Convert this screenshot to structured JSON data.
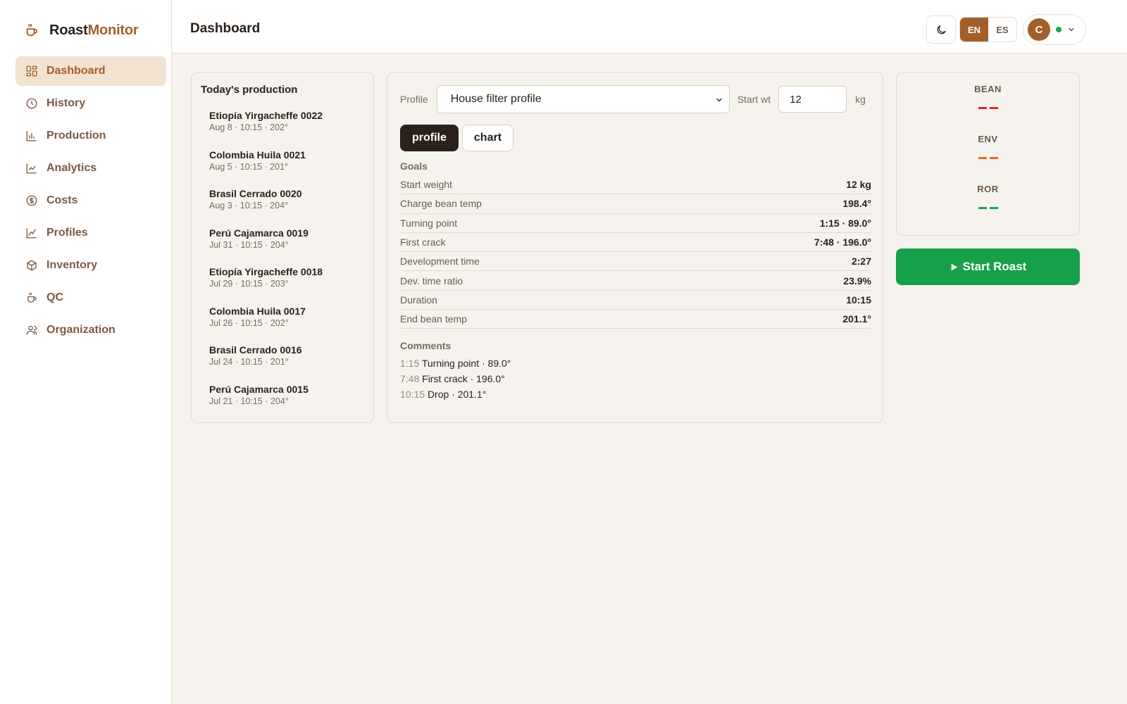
{
  "brand": {
    "part1": "Roast",
    "part2": "Monitor"
  },
  "sidebar": {
    "items": [
      {
        "label": "Dashboard",
        "icon": "dashboard-icon",
        "active": true
      },
      {
        "label": "History",
        "icon": "clock-icon",
        "active": false
      },
      {
        "label": "Production",
        "icon": "bar-chart-icon",
        "active": false
      },
      {
        "label": "Analytics",
        "icon": "line-chart-icon",
        "active": false
      },
      {
        "label": "Costs",
        "icon": "dollar-icon",
        "active": false
      },
      {
        "label": "Profiles",
        "icon": "trend-icon",
        "active": false
      },
      {
        "label": "Inventory",
        "icon": "box-icon",
        "active": false
      },
      {
        "label": "QC",
        "icon": "cup-icon",
        "active": false
      },
      {
        "label": "Organization",
        "icon": "users-icon",
        "active": false
      }
    ]
  },
  "header": {
    "title": "Dashboard",
    "lang": {
      "en": "EN",
      "es": "ES",
      "selected": "EN"
    },
    "user_initial": "C",
    "user_status": "online"
  },
  "production": {
    "title": "Today's production",
    "items": [
      {
        "name": "Etiopía Yirgacheffe 0022",
        "meta": "Aug 8 · 10:15 · 202°"
      },
      {
        "name": "Colombia Huila 0021",
        "meta": "Aug 5 · 10:15 · 201°"
      },
      {
        "name": "Brasil Cerrado 0020",
        "meta": "Aug 3 · 10:15 · 204°"
      },
      {
        "name": "Perú Cajamarca 0019",
        "meta": "Jul 31 · 10:15 · 204°"
      },
      {
        "name": "Etiopía Yirgacheffe 0018",
        "meta": "Jul 29 · 10:15 · 203°"
      },
      {
        "name": "Colombia Huila 0017",
        "meta": "Jul 26 · 10:15 · 202°"
      },
      {
        "name": "Brasil Cerrado 0016",
        "meta": "Jul 24 · 10:15 · 201°"
      },
      {
        "name": "Perú Cajamarca 0015",
        "meta": "Jul 21 · 10:15 · 204°"
      }
    ]
  },
  "main": {
    "profile_label": "Profile",
    "profile_value": "House filter profile",
    "start_wt_label": "Start wt",
    "start_wt_value": "12",
    "unit": "kg",
    "tabs": [
      {
        "label": "profile",
        "active": true
      },
      {
        "label": "chart",
        "active": false
      }
    ],
    "goals_title": "Goals",
    "goals": [
      {
        "label": "Start weight",
        "value": "12 kg"
      },
      {
        "label": "Charge bean temp",
        "value": "198.4°"
      },
      {
        "label": "Turning point",
        "value": "1:15 · 89.0°"
      },
      {
        "label": "First crack",
        "value": "7:48 · 196.0°"
      },
      {
        "label": "Development time",
        "value": "2:27"
      },
      {
        "label": "Dev. time ratio",
        "value": "23.9%"
      },
      {
        "label": "Duration",
        "value": "10:15"
      },
      {
        "label": "End bean temp",
        "value": "201.1°"
      }
    ],
    "comments_title": "Comments",
    "comments": [
      {
        "time": "1:15",
        "text": "Turning point · 89.0°"
      },
      {
        "time": "7:48",
        "text": "First crack · 196.0°"
      },
      {
        "time": "10:15",
        "text": "Drop · 201.1°"
      }
    ]
  },
  "gauges": [
    {
      "name": "BEAN",
      "value": "--",
      "color": "#d62b2b"
    },
    {
      "name": "ENV",
      "value": "--",
      "color": "#e86a1f"
    },
    {
      "name": "ROR",
      "value": "--",
      "color": "#1fa352"
    }
  ],
  "actions": {
    "start_label": "Start Roast",
    "start_color": "#17a04a"
  }
}
